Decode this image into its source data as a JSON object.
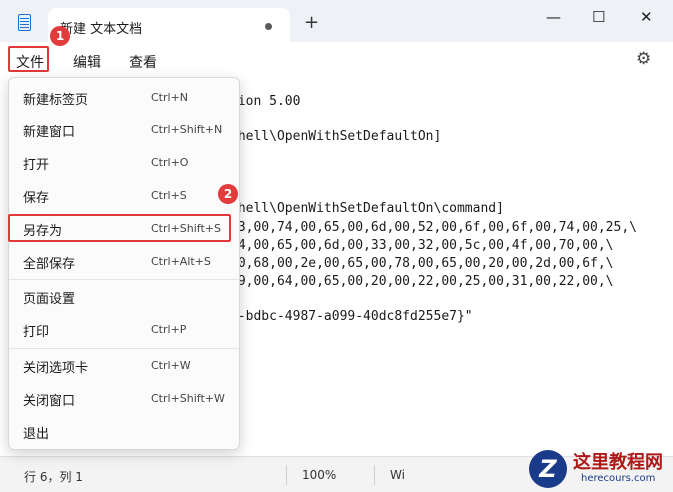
{
  "titlebar": {
    "tab_title": "新建 文本文档",
    "new_tab": "+",
    "minimize": "—",
    "maximize": "☐",
    "close": "✕"
  },
  "menubar": {
    "file": "文件",
    "edit": "编辑",
    "view": "查看"
  },
  "badges": {
    "first": "1",
    "second": "2"
  },
  "editor": {
    "lines": [
      "sion 5.00",
      "shell\\OpenWithSetDefaultOn]",
      "shell\\OpenWithSetDefaultOn\\command]",
      "73,00,74,00,65,00,6d,00,52,00,6f,00,6f,00,74,00,25,\\",
      "74,00,65,00,6d,00,33,00,32,00,5c,00,4f,00,70,00,\\",
      "00,68,00,2e,00,65,00,78,00,65,00,20,00,2d,00,6f,\\",
      "59,00,64,00,65,00,20,00,22,00,25,00,31,00,22,00,\\",
      "3-bdbc-4987-a099-40dc8fd255e7}\""
    ]
  },
  "file_menu": {
    "items": [
      {
        "label": "新建标签页",
        "shortcut": "Ctrl+N"
      },
      {
        "label": "新建窗口",
        "shortcut": "Ctrl+Shift+N"
      },
      {
        "label": "打开",
        "shortcut": "Ctrl+O"
      },
      {
        "label": "保存",
        "shortcut": "Ctrl+S"
      },
      {
        "label": "另存为",
        "shortcut": "Ctrl+Shift+S"
      },
      {
        "label": "全部保存",
        "shortcut": "Ctrl+Alt+S"
      },
      {
        "label": "页面设置",
        "shortcut": ""
      },
      {
        "label": "打印",
        "shortcut": "Ctrl+P"
      },
      {
        "label": "关闭选项卡",
        "shortcut": "Ctrl+W"
      },
      {
        "label": "关闭窗口",
        "shortcut": "Ctrl+Shift+W"
      },
      {
        "label": "退出",
        "shortcut": ""
      }
    ]
  },
  "statusbar": {
    "position": "行 6，列 1",
    "zoom": "100%",
    "line_ending": "Wi"
  },
  "watermark": {
    "logo_letter": "Z",
    "title": "这里教程网",
    "url": "herecours.com"
  },
  "colors": {
    "highlight": "#e03a3a",
    "badge": "#e23b3b",
    "accent": "#1f6fd1"
  }
}
